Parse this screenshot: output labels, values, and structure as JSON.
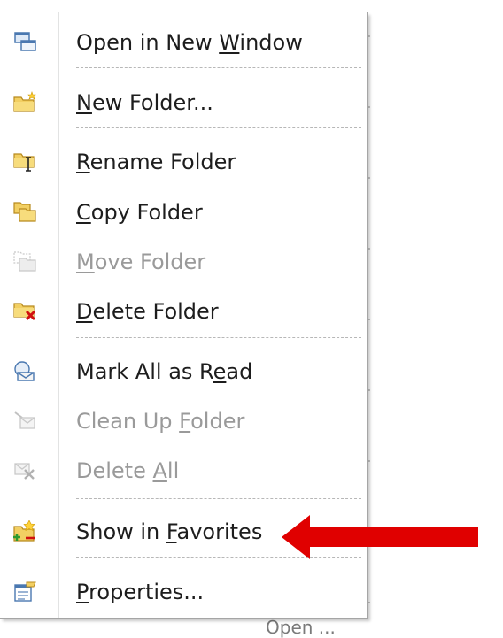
{
  "menu": {
    "items": [
      {
        "icon": "new-window-icon",
        "pre": "Open in New ",
        "acc": "W",
        "post": "indow",
        "enabled": true
      },
      {
        "icon": "new-folder-icon",
        "pre": "",
        "acc": "N",
        "post": "ew Folder...",
        "enabled": true
      },
      {
        "icon": "rename-folder-icon",
        "pre": "",
        "acc": "R",
        "post": "ename Folder",
        "enabled": true
      },
      {
        "icon": "copy-folder-icon",
        "pre": "",
        "acc": "C",
        "post": "opy Folder",
        "enabled": true
      },
      {
        "icon": "move-folder-icon",
        "pre": "",
        "acc": "M",
        "post": "ove Folder",
        "enabled": false
      },
      {
        "icon": "delete-folder-icon",
        "pre": "",
        "acc": "D",
        "post": "elete Folder",
        "enabled": true
      },
      {
        "icon": "mark-read-icon",
        "pre": "Mark All as R",
        "acc": "e",
        "post": "ad",
        "enabled": true
      },
      {
        "icon": "clean-up-icon",
        "pre": "Clean Up ",
        "acc": "F",
        "post": "older",
        "enabled": false
      },
      {
        "icon": "delete-all-icon",
        "pre": "Delete ",
        "acc": "A",
        "post": "ll",
        "enabled": false
      },
      {
        "icon": "favorites-icon",
        "pre": "Show in ",
        "acc": "F",
        "post": "avorites",
        "enabled": true
      },
      {
        "icon": "properties-icon",
        "pre": "",
        "acc": "P",
        "post": "roperties...",
        "enabled": true
      }
    ]
  },
  "background": {
    "partial_text": "Open ..."
  },
  "colors": {
    "arrow": "#e00000",
    "text": "#1d1d1d",
    "disabled_text": "#9a9a9a"
  }
}
